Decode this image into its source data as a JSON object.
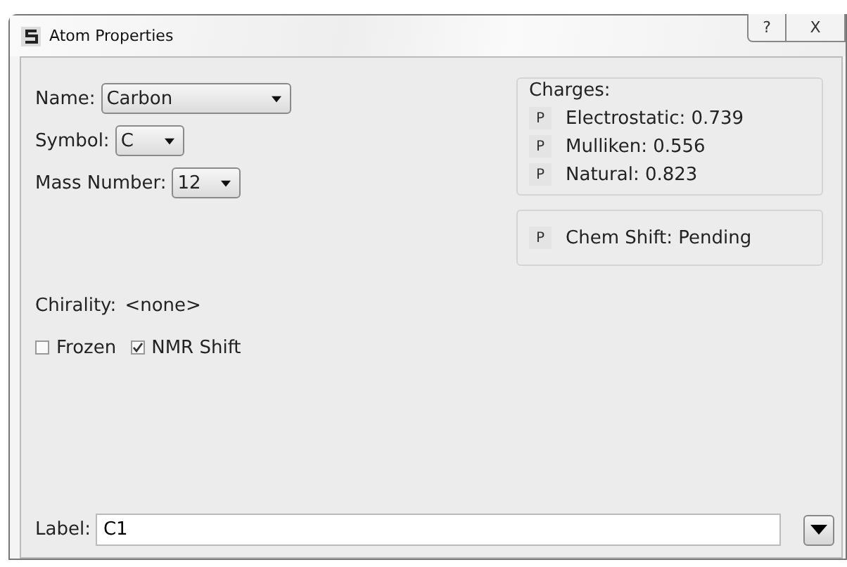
{
  "window": {
    "title": "Atom Properties"
  },
  "title_buttons": [
    {
      "kind": "help",
      "label": "?"
    },
    {
      "kind": "close",
      "label": "X"
    }
  ],
  "selects": [
    {
      "label": "Name:",
      "value": "Carbon"
    },
    {
      "label": "Symbol:",
      "value": "C"
    },
    {
      "label": "Mass Number:",
      "value": "12"
    }
  ],
  "chirality": {
    "label": "Chirality:",
    "value": "<none>"
  },
  "checkboxes": [
    {
      "label": "Frozen",
      "checked": false
    },
    {
      "label": "NMR Shift",
      "checked": true
    }
  ],
  "charges": {
    "title": "Charges:",
    "items": [
      {
        "button": "P",
        "text": "Electrostatic: 0.739"
      },
      {
        "button": "P",
        "text": "Mulliken: 0.556"
      },
      {
        "button": "P",
        "text": "Natural: 0.823"
      }
    ]
  },
  "chem_shift": {
    "button": "P",
    "text": "Chem Shift: Pending"
  },
  "label_field": {
    "label": "Label:",
    "value": "C1"
  }
}
